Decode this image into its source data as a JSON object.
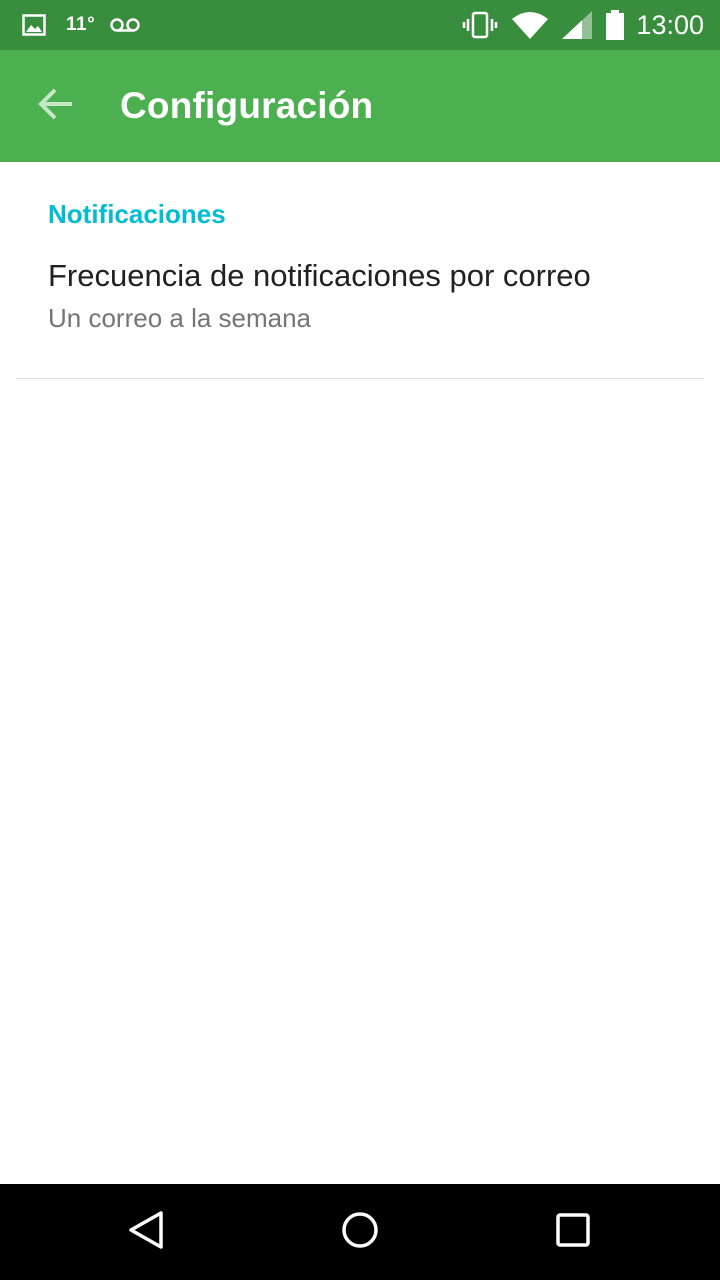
{
  "status_bar": {
    "temperature": "11°",
    "time": "13:00",
    "icons": [
      "image-icon",
      "voicemail-icon",
      "vibrate-icon",
      "wifi-icon",
      "signal-icon",
      "battery-icon"
    ]
  },
  "app_bar": {
    "title": "Configuración",
    "back_icon": "arrow-back-icon"
  },
  "settings": {
    "section_title": "Notificaciones",
    "items": [
      {
        "title": "Frecuencia de notificaciones por correo",
        "summary": "Un correo a la semana"
      }
    ]
  },
  "navigation": {
    "icons": [
      "back-triangle-icon",
      "home-circle-icon",
      "recents-square-icon"
    ]
  },
  "colors": {
    "status_bar": "#388e3c",
    "app_bar": "#4caf50",
    "section_accent": "#00bcd4"
  }
}
